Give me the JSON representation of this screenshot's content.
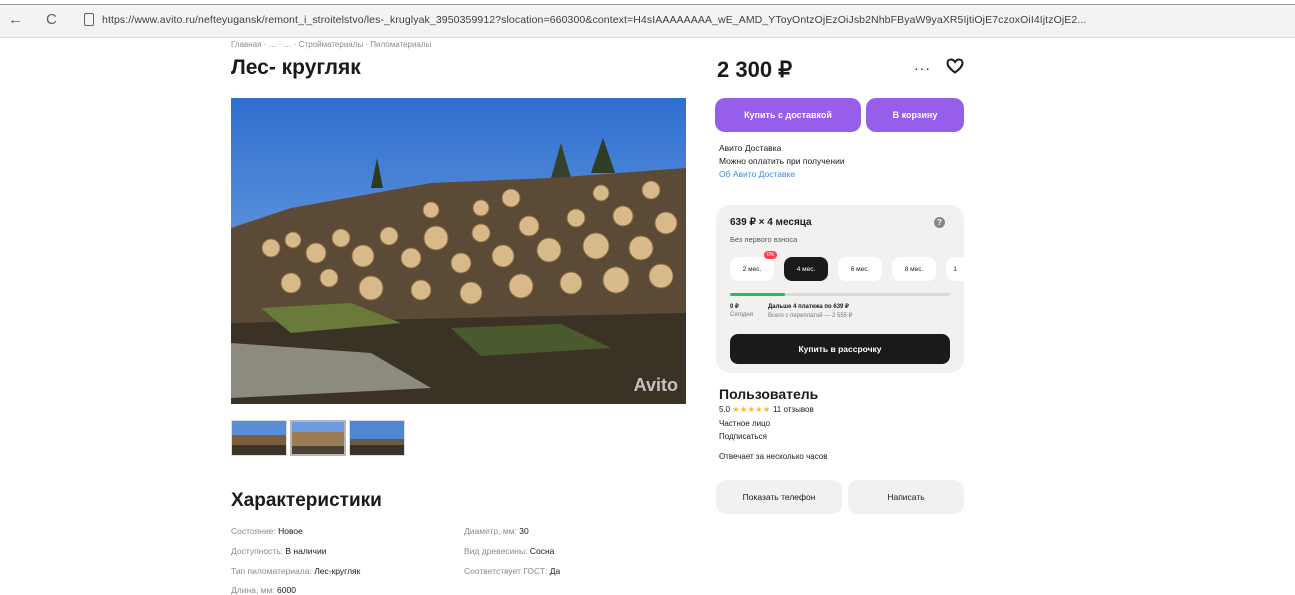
{
  "browser": {
    "back": "←",
    "reload": "C",
    "url": "https://www.avito.ru/nefteyugansk/remont_i_stroitelstvo/les-_kruglyak_3950359912?slocation=660300&context=H4sIAAAAAAAA_wE_AMD_YToyOntzOjEzOiJsb2NhbFByaW9yaXR5IjtiOjE7czoxOiI4IjtzOjE2..."
  },
  "breadcrumb": "Главная · … · … · Стройматериалы · Пиломатериалы",
  "title": "Лес- кругляк",
  "photo": {
    "watermark": "Avito"
  },
  "characteristics": {
    "heading": "Характеристики",
    "items": [
      {
        "key": "Состояние: ",
        "value": "Новое"
      },
      {
        "key": "Доступность: ",
        "value": "В наличии"
      },
      {
        "key": "Тип пиломатериала: ",
        "value": "Лес-кругляк"
      },
      {
        "key": "Длина, мм: ",
        "value": "6000"
      },
      {
        "key": "Диаметр, мм: ",
        "value": "30"
      },
      {
        "key": "Вид древесины: ",
        "value": "Сосна"
      },
      {
        "key": "Соответствует ГОСТ: ",
        "value": "Да"
      }
    ]
  },
  "price": "2 300 ₽",
  "actions": {
    "more": "···",
    "buy_delivery": "Купить с доставкой",
    "to_cart": "В корзину"
  },
  "delivery": {
    "line1": "Авито Доставка",
    "line2": "Можно оплатить при получении",
    "link": "Об Авито Доставке"
  },
  "installment": {
    "title": "639 ₽ × 4 месяца",
    "subtitle": "Без первого взноса",
    "help": "?",
    "terms": [
      "2 мес.",
      "4 мес.",
      "6 мес.",
      "8 мес.",
      "1"
    ],
    "badge": "0%",
    "progress": 0.25,
    "today_amount": "0 ₽",
    "today_label": "Сегодня",
    "further": "Дальше 4 платежа по 639 ₽",
    "total": "Всего с переплатой — 2 555 ₽",
    "button": "Купить в рассрочку"
  },
  "seller": {
    "name": "Пользователь",
    "rating": "5.0",
    "stars": "★★★★★",
    "reviews": "11 отзывов",
    "type": "Частное лицо",
    "subscribe": "Подписаться",
    "response": "Отвечает за несколько часов",
    "show_phone": "Показать телефон",
    "write": "Написать"
  }
}
